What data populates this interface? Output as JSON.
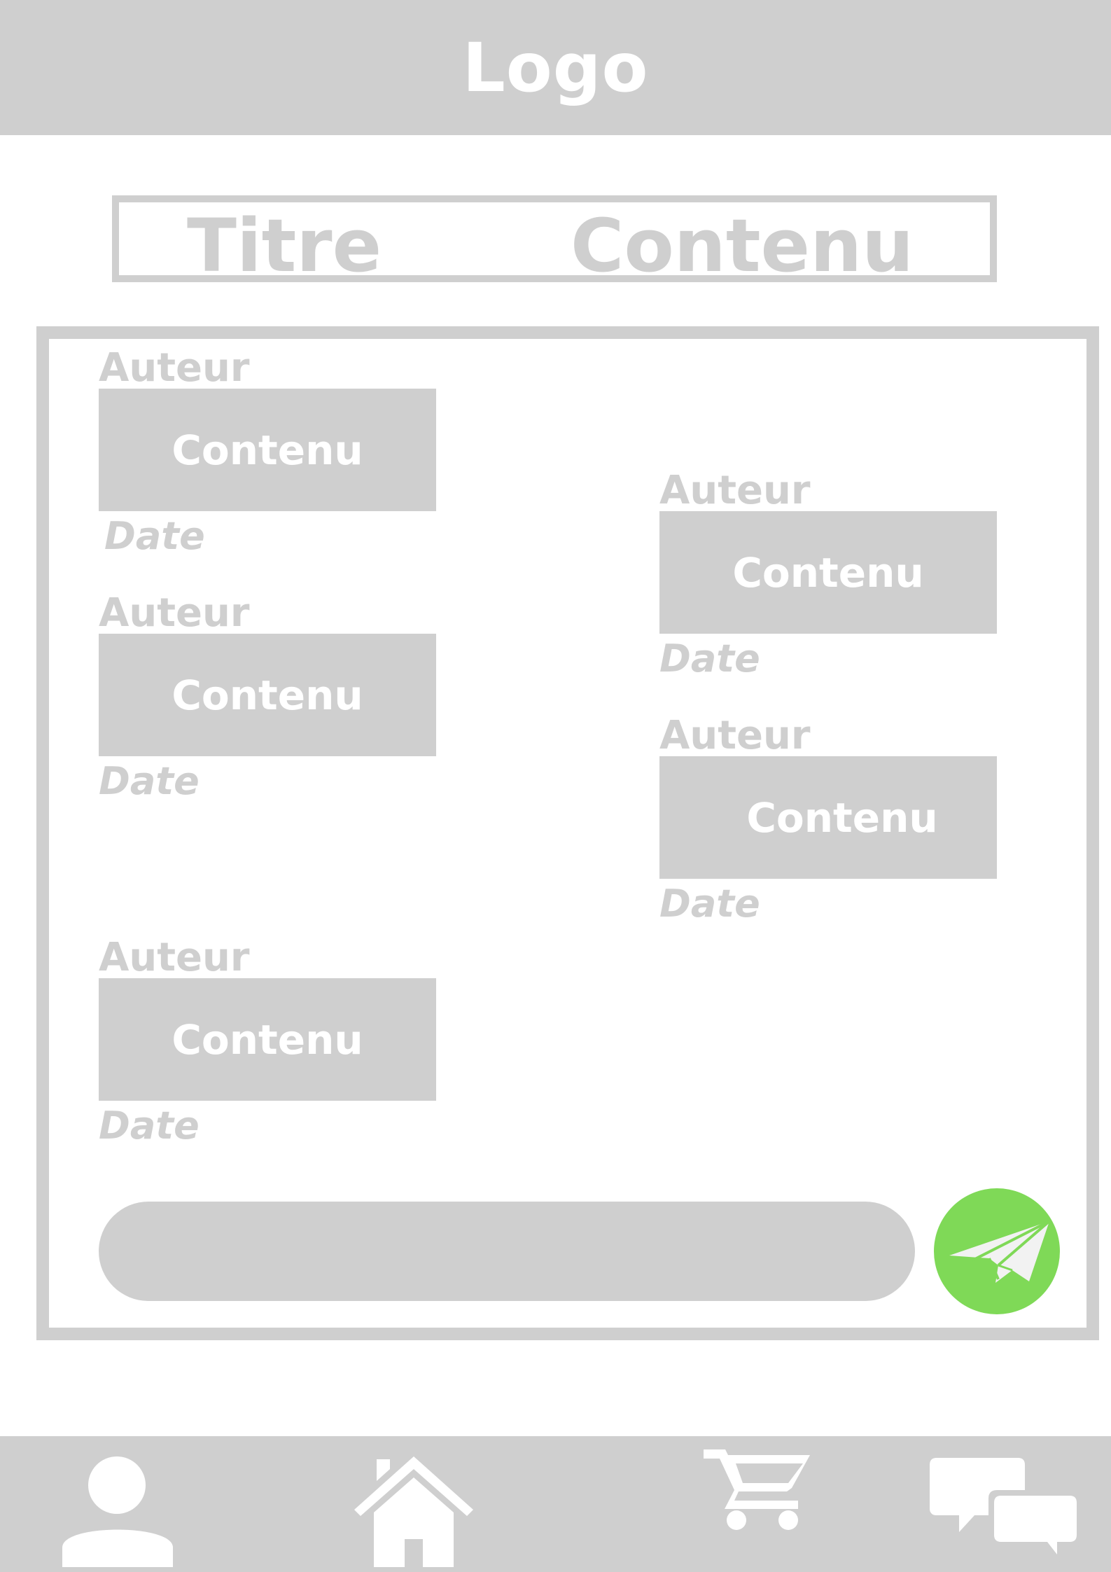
{
  "header": {
    "logo": "Logo"
  },
  "title_bar": {
    "title": "Titre",
    "content": "Contenu"
  },
  "messages": [
    {
      "author": "Auteur",
      "content": "Contenu",
      "date": "Date",
      "side": "left"
    },
    {
      "author": "Auteur",
      "content": "Contenu",
      "date": "Date",
      "side": "right"
    },
    {
      "author": "Auteur",
      "content": "Contenu",
      "date": "Date",
      "side": "left"
    },
    {
      "author": "Auteur",
      "content": "Contenu",
      "date": "Date",
      "side": "right"
    },
    {
      "author": "Auteur",
      "content": "Contenu",
      "date": "Date",
      "side": "left"
    }
  ],
  "composer": {
    "value": "",
    "send_icon": "paper-plane-icon"
  },
  "bottom_nav": {
    "items": [
      {
        "icon": "user-icon"
      },
      {
        "icon": "home-icon"
      },
      {
        "icon": "shopping-cart-icon"
      },
      {
        "icon": "chat-bubbles-icon"
      }
    ]
  },
  "colors": {
    "gray": "#cfcfcf",
    "white": "#ffffff",
    "send_green": "#7fd957"
  }
}
